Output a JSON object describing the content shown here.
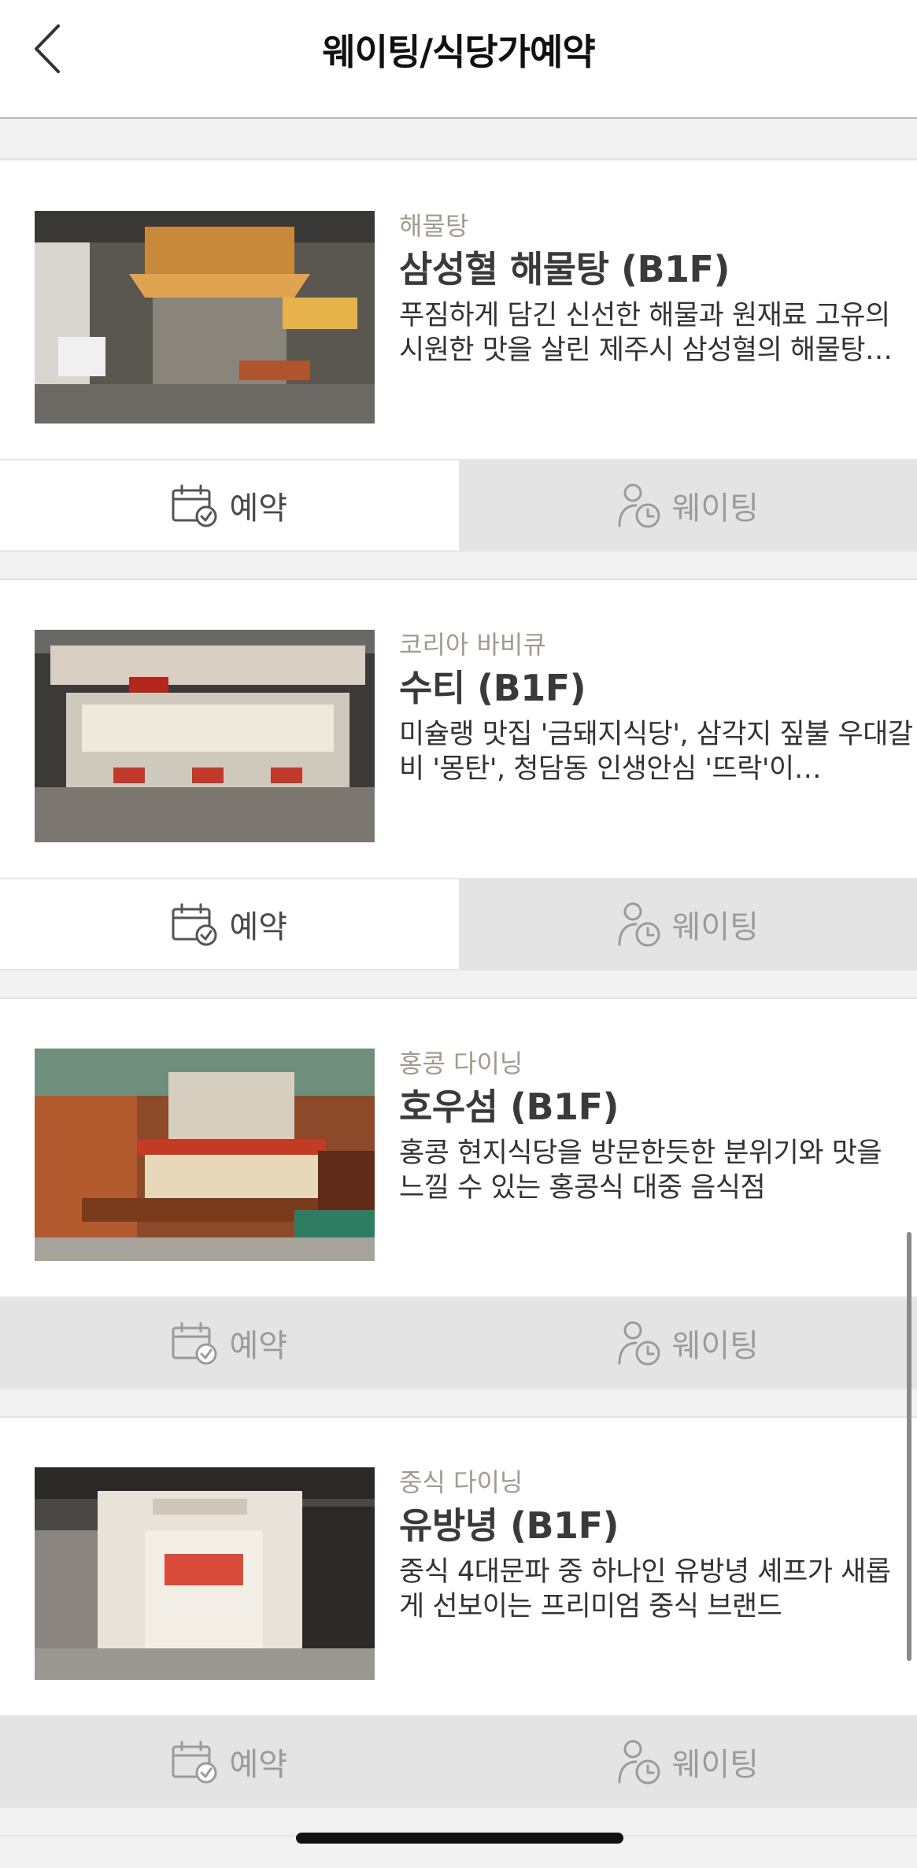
{
  "header": {
    "title": "웨이팅/식당가예약"
  },
  "actions": {
    "reserve_label": "예약",
    "waiting_label": "웨이팅"
  },
  "restaurants": [
    {
      "category": "해물탕",
      "name": "삼성혈 해물탕 (B1F)",
      "description": "푸짐하게 담긴 신선한 해물과 원재료 고유의 시원한 맛을 살린 제주시 삼성혈의 해물탕…",
      "reserve_enabled": true,
      "waiting_enabled": false
    },
    {
      "category": "코리아 바비큐",
      "name": "수티 (B1F)",
      "description": "미슐랭 맛집 '금돼지식당', 삼각지 짚불 우대갈비 '몽탄', 청담동 인생안심 '뜨락'이…",
      "reserve_enabled": true,
      "waiting_enabled": false
    },
    {
      "category": "홍콩 다이닝",
      "name": "호우섬 (B1F)",
      "description": "홍콩 현지식당을 방문한듯한 분위기와 맛을 느낄 수 있는 홍콩식 대중 음식점",
      "reserve_enabled": false,
      "waiting_enabled": false
    },
    {
      "category": "중식 다이닝",
      "name": "유방녕 (B1F)",
      "description": "중식 4대문파 중 하나인 유방녕 셰프가 새롭게 선보이는 프리미엄 중식 브랜드",
      "reserve_enabled": false,
      "waiting_enabled": false
    }
  ]
}
